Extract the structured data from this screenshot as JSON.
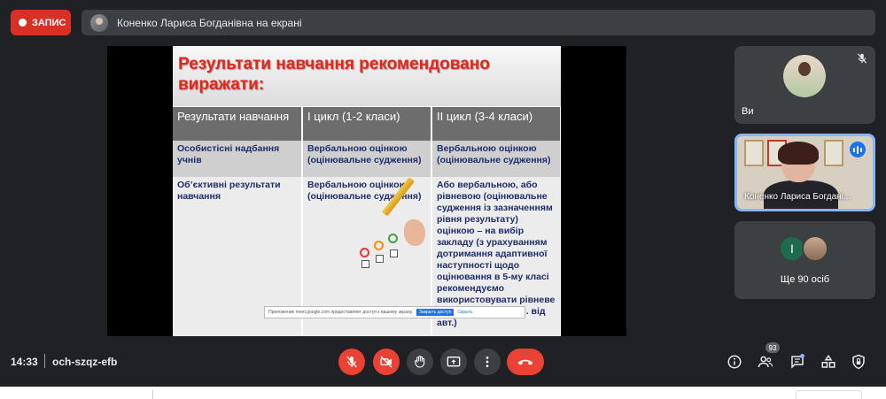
{
  "recording": {
    "label": "ЗАПИС",
    "color": "#d93025"
  },
  "banner": {
    "text": "Коненко Лариса Богданівна на екрані"
  },
  "slide": {
    "title": "Результати навчання рекомендовано виражати:",
    "headers": [
      "Результати навчання",
      "I цикл (1-2 класи)",
      "II цикл (3-4 класи)"
    ],
    "rows": [
      [
        "Особистісні надбання учнів",
        "Вербальною оцінкою (оцінювальне судження)",
        "Вербальною оцінкою (оцінювальне судження)"
      ],
      [
        "Об’єктивні результати навчання",
        "Вербальною оцінкою (оцінювальне судження)",
        "Або вербальною, або рівневою (оцінювальне судження із зазначенням рівня результату) оцінкою – на вибір закладу (з урахуванням дотримання адаптивної наступності щодо оцінювання в 5-му класі рекомендуємо використовувати рівневе оцінювання – прим. від авт.)"
      ]
    ],
    "share_bar": {
      "text": "Приложение meet.google.com предоставляет доступ к вашему экрану.",
      "stop_label": "Закрыть доступ",
      "hide_label": "Скрыть"
    }
  },
  "participants": {
    "you": {
      "name": "Ви",
      "muted": true
    },
    "speaker": {
      "name": "Коненко Лариса Богдані..."
    },
    "more": {
      "initial": "І",
      "label": "Ще 90 осіб"
    }
  },
  "bottom_bar": {
    "time": "14:33",
    "meeting_code": "och-szqz-efb",
    "people_count": "93",
    "controls": [
      "mic-off",
      "camera-off",
      "raise-hand",
      "present",
      "more-options",
      "leave-call"
    ],
    "right_icons": [
      "info",
      "people",
      "chat",
      "activities",
      "host-controls"
    ]
  },
  "colors": {
    "accent_red": "#ea4335",
    "background": "#202124",
    "tile": "#3c4043",
    "highlight": "#8ab4f8"
  }
}
